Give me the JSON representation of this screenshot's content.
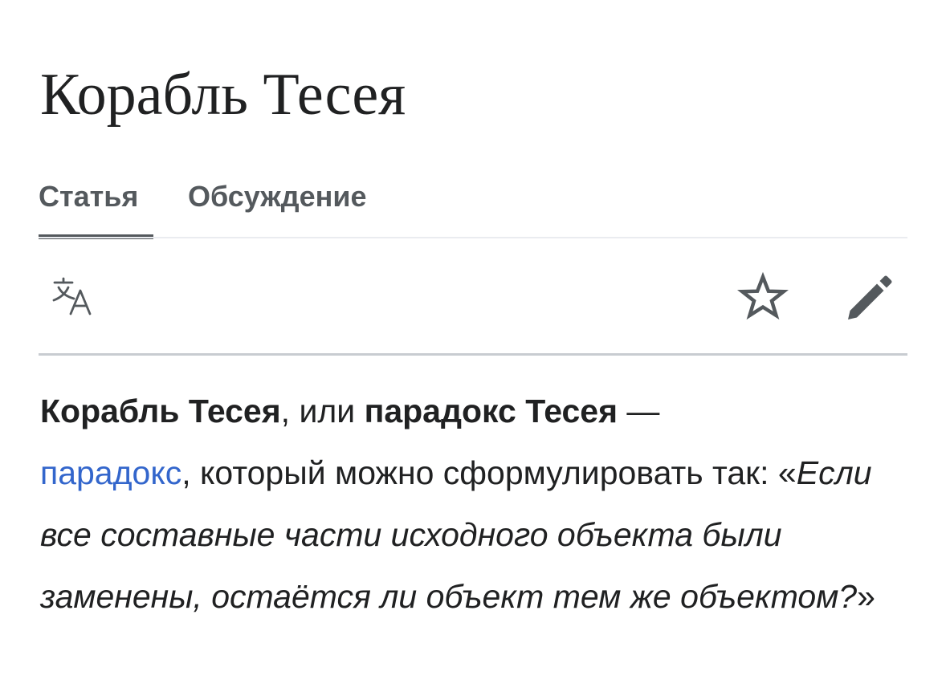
{
  "page": {
    "title": "Корабль Тесея"
  },
  "tabs": {
    "article_label": "Статья",
    "talk_label": "Обсуждение",
    "active": "article"
  },
  "toolbar": {
    "language_icon": "translate-icon",
    "watch_icon": "star-outline-icon",
    "edit_icon": "pencil-icon",
    "icon_color": "#54595d"
  },
  "lead": {
    "term1": "Корабль Тесея",
    "sep1": ", или ",
    "term2": "парадокс Тесея",
    "dash": " —",
    "link_text": "парадокс",
    "text1": ", который можно сформулировать так: ",
    "quote_open": "«",
    "quote": "Если все составные части исходного объекта были заменены, остаётся ли объект тем же объектом?",
    "quote_close": "»"
  },
  "colors": {
    "text": "#202122",
    "tab_text": "#54595d",
    "link": "#3366cc",
    "divider": "#c8ccd1",
    "tab_divider": "#eaecf0"
  }
}
